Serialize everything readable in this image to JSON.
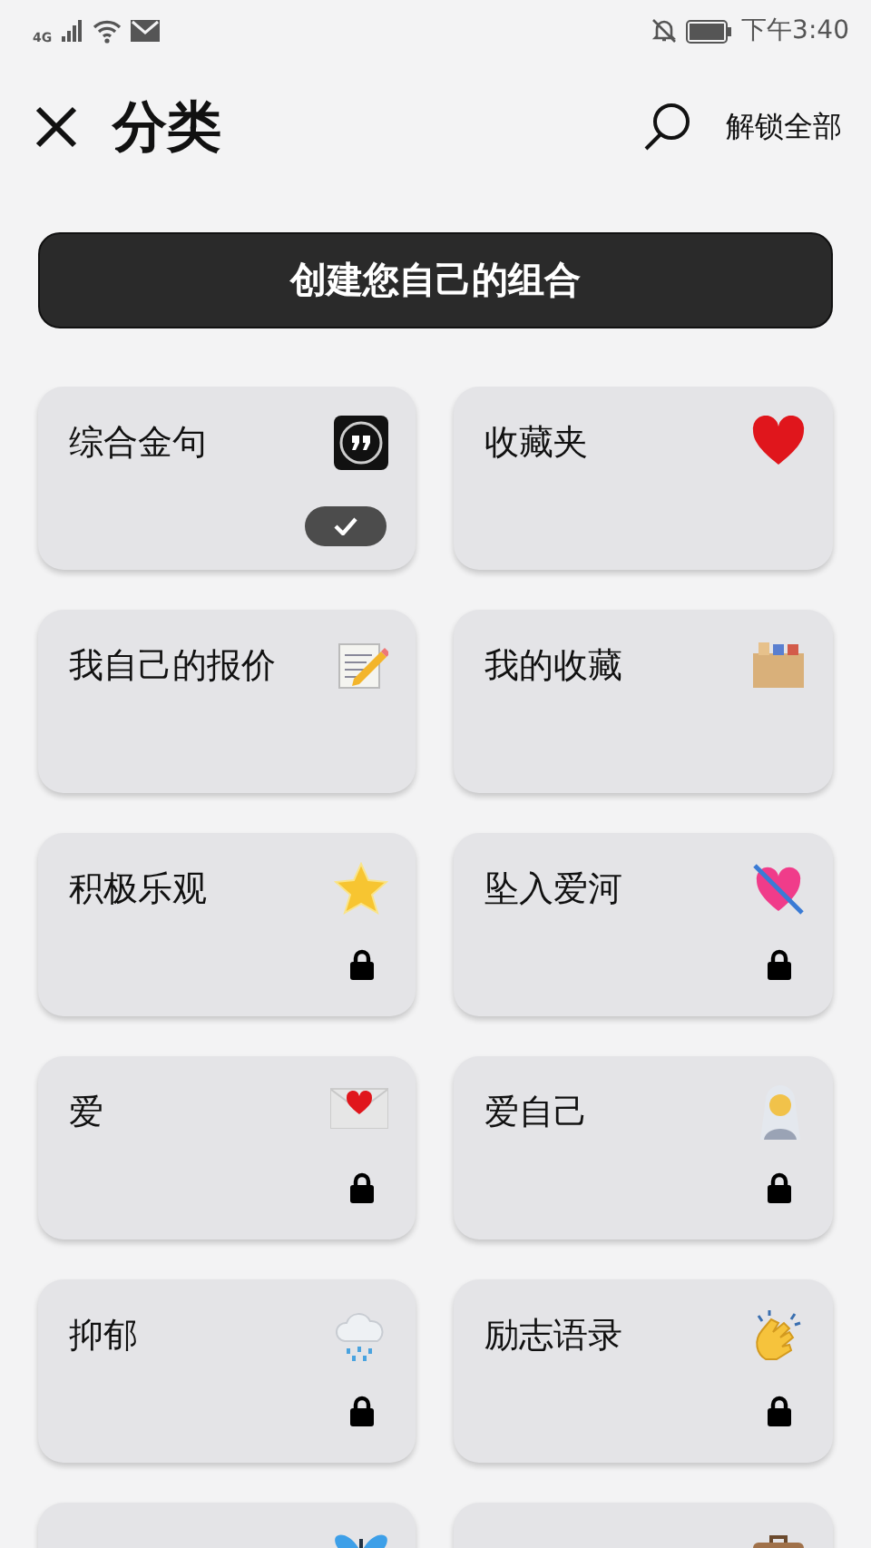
{
  "status_bar": {
    "network": "4G",
    "time": "下午3:40"
  },
  "header": {
    "title": "分类",
    "unlock_all": "解锁全部"
  },
  "create_button": "创建您自己的组合",
  "categories": [
    {
      "kind": "full",
      "label": "综合金句",
      "selected": true,
      "locked": false
    },
    {
      "kind": "full",
      "label": "收藏夹",
      "selected": false,
      "locked": false
    },
    {
      "kind": "full",
      "label": "我自己的报价",
      "selected": false,
      "locked": false
    },
    {
      "kind": "full",
      "label": "我的收藏",
      "selected": false,
      "locked": false
    },
    {
      "kind": "full",
      "label": "积极乐观",
      "selected": false,
      "locked": true
    },
    {
      "kind": "full",
      "label": "坠入爱河",
      "selected": false,
      "locked": true
    },
    {
      "kind": "full",
      "label": "爱",
      "selected": false,
      "locked": true
    },
    {
      "kind": "full",
      "label": "爱自己",
      "selected": false,
      "locked": true
    },
    {
      "kind": "full",
      "label": "抑郁",
      "selected": false,
      "locked": true
    },
    {
      "kind": "full",
      "label": "励志语录",
      "selected": false,
      "locked": true
    },
    {
      "kind": "clipped"
    },
    {
      "kind": "clipped"
    }
  ]
}
